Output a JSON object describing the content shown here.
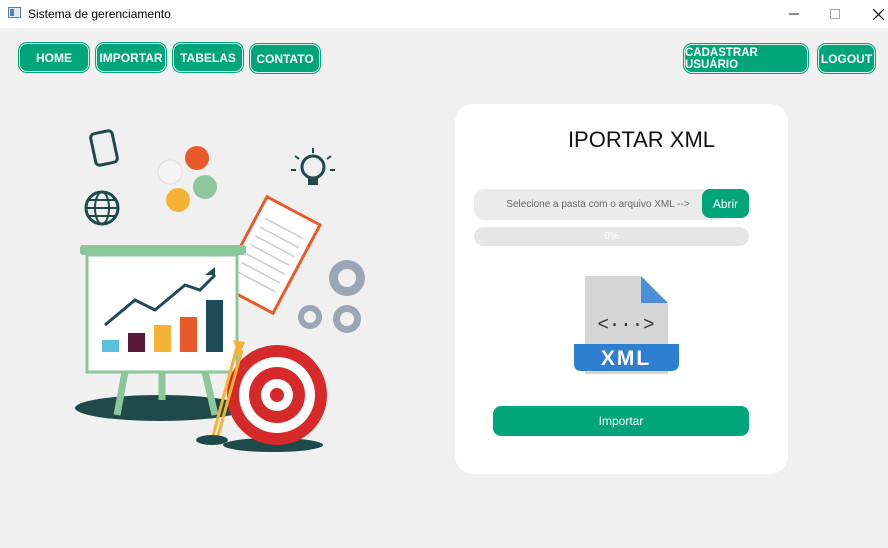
{
  "window": {
    "title": "Sistema de gerenciamento"
  },
  "nav": {
    "left": [
      "HOME",
      "IMPORTAR",
      "TABELAS",
      "CONTATO"
    ],
    "register_label": "CADASTRAR USUÁRIO",
    "logout_label": "LOGOUT"
  },
  "card": {
    "title": "IPORTAR XML",
    "file_placeholder": "Selecione a pasta com o arquivo XML -->",
    "open_label": "Abrir",
    "progress_value": 0,
    "progress_text": "0%",
    "file_icon_text": "XML",
    "file_icon_code": "<···>",
    "import_label": "Importar"
  },
  "colors": {
    "accent": "#00a67a",
    "background": "#f0f0f0"
  }
}
